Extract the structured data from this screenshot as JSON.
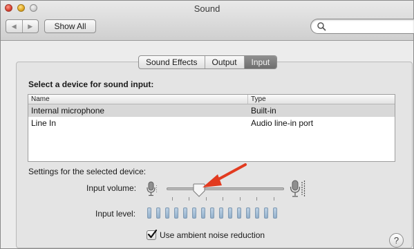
{
  "window": {
    "title": "Sound"
  },
  "toolbar": {
    "back_icon": "chevron-left-icon",
    "forward_icon": "chevron-right-icon",
    "show_all_label": "Show All",
    "search_placeholder": "",
    "search_icon": "search-icon"
  },
  "tabs": [
    {
      "label": "Sound Effects",
      "selected": false
    },
    {
      "label": "Output",
      "selected": false
    },
    {
      "label": "Input",
      "selected": true
    }
  ],
  "input": {
    "heading": "Select a device for sound input:",
    "columns": {
      "name": "Name",
      "type": "Type"
    },
    "devices": [
      {
        "name": "Internal microphone",
        "type": "Built-in",
        "selected": true
      },
      {
        "name": "Line In",
        "type": "Audio line-in port",
        "selected": false
      }
    ],
    "settings_label": "Settings for the selected device:",
    "volume_label": "Input volume:",
    "volume_value": 0.25,
    "level_label": "Input level:",
    "level_segments": 15,
    "level_active": 0,
    "noise_reduction_label": "Use ambient noise reduction",
    "noise_reduction_checked": true
  },
  "help": {
    "label": "?"
  },
  "colors": {
    "annotation_arrow": "#e23b20",
    "selected_tab": "#7c7c7c",
    "level_led": "#a7c0d8"
  }
}
